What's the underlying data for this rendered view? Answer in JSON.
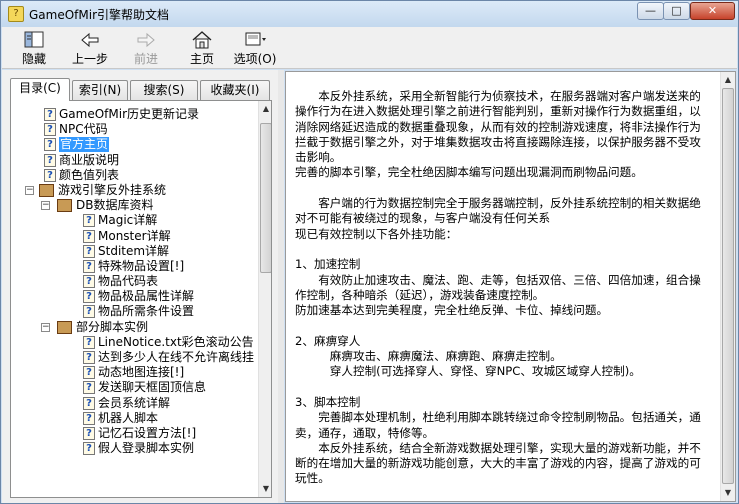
{
  "window": {
    "title": "GameOfMir引擎帮助文档",
    "minimize_glyph": "—",
    "maximize_glyph": "□",
    "close_glyph": "✕"
  },
  "toolbar": {
    "hide": "隐藏",
    "back": "上一步",
    "forward": "前进",
    "home": "主页",
    "options": "选项(O)"
  },
  "tabs": [
    {
      "label": "目录(C)",
      "active": true
    },
    {
      "label": "索引(N)",
      "active": false
    },
    {
      "label": "搜索(S)",
      "active": false
    },
    {
      "label": "收藏夹(I)",
      "active": false
    }
  ],
  "tree": [
    {
      "label": "GameOfMir历史更新记录",
      "level": 2,
      "type": "page"
    },
    {
      "label": "NPC代码",
      "level": 2,
      "type": "page"
    },
    {
      "label": "官方主页",
      "level": 2,
      "type": "page",
      "selected": true
    },
    {
      "label": "商业版说明",
      "level": 2,
      "type": "page"
    },
    {
      "label": "颜色值列表",
      "level": 2,
      "type": "page"
    },
    {
      "label": "游戏引擎反外挂系统",
      "level": 1,
      "type": "book",
      "expander": "−"
    },
    {
      "label": "DB数据库资料",
      "level": 2,
      "type": "book",
      "expander": "−"
    },
    {
      "label": "Magic详解",
      "level": 3,
      "type": "page"
    },
    {
      "label": "Monster详解",
      "level": 3,
      "type": "page"
    },
    {
      "label": "Stditem详解",
      "level": 3,
      "type": "page"
    },
    {
      "label": "特殊物品设置[!]",
      "level": 3,
      "type": "page"
    },
    {
      "label": "物品代码表",
      "level": 3,
      "type": "page"
    },
    {
      "label": "物品极品属性详解",
      "level": 3,
      "type": "page"
    },
    {
      "label": "物品所需条件设置",
      "level": 3,
      "type": "page"
    },
    {
      "label": "部分脚本实例",
      "level": 2,
      "type": "book",
      "expander": "−"
    },
    {
      "label": "LineNotice.txt彩色滚动公告",
      "level": 3,
      "type": "page"
    },
    {
      "label": "达到多少人在线不允许离线挂",
      "level": 3,
      "type": "page"
    },
    {
      "label": "动态地图连接[!]",
      "level": 3,
      "type": "page"
    },
    {
      "label": "发送聊天框固顶信息",
      "level": 3,
      "type": "page"
    },
    {
      "label": "会员系统详解",
      "level": 3,
      "type": "page"
    },
    {
      "label": "机器人脚本",
      "level": 3,
      "type": "page"
    },
    {
      "label": "记忆石设置方法[!]",
      "level": 3,
      "type": "page"
    },
    {
      "label": "假人登录脚本实例",
      "level": 3,
      "type": "page"
    }
  ],
  "content": {
    "paragraphs": [
      {
        "style": "ind",
        "text": "本反外挂系统，采用全新智能行为侦察技术，在服务器端对客户端发送来的操作行为在进入数据处理引擎之前进行智能判别，重新对操作行为数据重组，以消除网络延迟造成的数据重叠现象，从而有效的控制游戏速度，将非法操作行为拦截于数据引擎之外，对于堆集数据攻击将直接踢除连接，以保护服务器不受攻击影响。"
      },
      {
        "style": "",
        "text": "完善的脚本引擎，完全杜绝因脚本编写问题出现漏洞而刷物品问题。"
      },
      {
        "style": "blank",
        "text": ""
      },
      {
        "style": "ind",
        "text": "客户端的行为数据控制完全于服务器端控制，反外挂系统控制的相关数据绝对不可能有被绕过的现象，与客户端没有任何关系"
      },
      {
        "style": "",
        "text": "现已有效控制以下各外挂功能："
      },
      {
        "style": "blank",
        "text": ""
      },
      {
        "style": "",
        "text": "1、加速控制"
      },
      {
        "style": "ind",
        "text": "有效防止加速攻击、魔法、跑、走等，包括双倍、三倍、四倍加速，组合操作控制，各种暗杀（延迟），游戏装备速度控制。"
      },
      {
        "style": "",
        "text": "防加速基本达到完美程度，完全杜绝反弹、卡位、掉线问题。"
      },
      {
        "style": "blank",
        "text": ""
      },
      {
        "style": "",
        "text": "2、麻痹穿人"
      },
      {
        "style": "ind2",
        "text": "麻痹攻击、麻痹魔法、麻痹跑、麻痹走控制。"
      },
      {
        "style": "ind2",
        "text": "穿人控制(可选择穿人、穿怪、穿NPC、攻城区域穿人控制)。"
      },
      {
        "style": "blank",
        "text": ""
      },
      {
        "style": "",
        "text": "3、脚本控制"
      },
      {
        "style": "ind",
        "text": "完善脚本处理机制，杜绝利用脚本跳转绕过命令控制刷物品。包括通关，通卖，通存，通取，特修等。"
      },
      {
        "style": "ind",
        "text": "本反外挂系统，结合全新游戏数据处理引擎，实现大量的游戏新功能，并不断的在增加大量的新游戏功能创意，大大的丰富了游戏的内容，提高了游戏的可玩性。"
      }
    ]
  }
}
